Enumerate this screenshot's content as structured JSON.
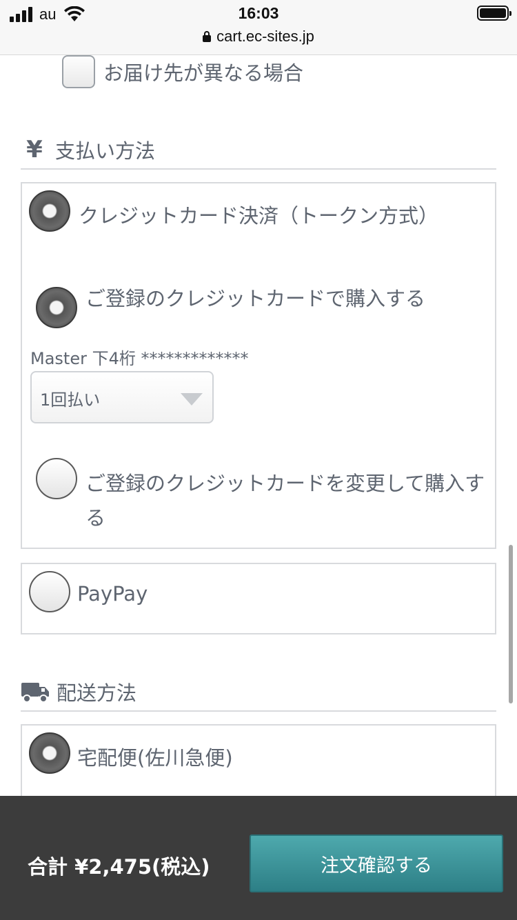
{
  "status_bar": {
    "carrier": "au",
    "time": "16:03",
    "url": "cart.ec-sites.jp"
  },
  "delivery_address": {
    "checkbox_label": "お届け先が異なる場合"
  },
  "payment": {
    "heading": "支払い方法",
    "icon": "¥",
    "credit_card_option": "クレジットカード決済（トークン方式）",
    "registered_card_option": "ご登録のクレジットカードで購入する",
    "card_info": "Master 下4桁 *************",
    "installment_selected": "1回払い",
    "change_card_option": "ご登録のクレジットカードを変更して購入する",
    "paypay_option": "PayPay"
  },
  "shipping": {
    "heading": "配送方法",
    "option": "宅配便(佐川急便)"
  },
  "footer": {
    "total": "合計 ¥2,475(税込)",
    "confirm_button": "注文確認する"
  }
}
